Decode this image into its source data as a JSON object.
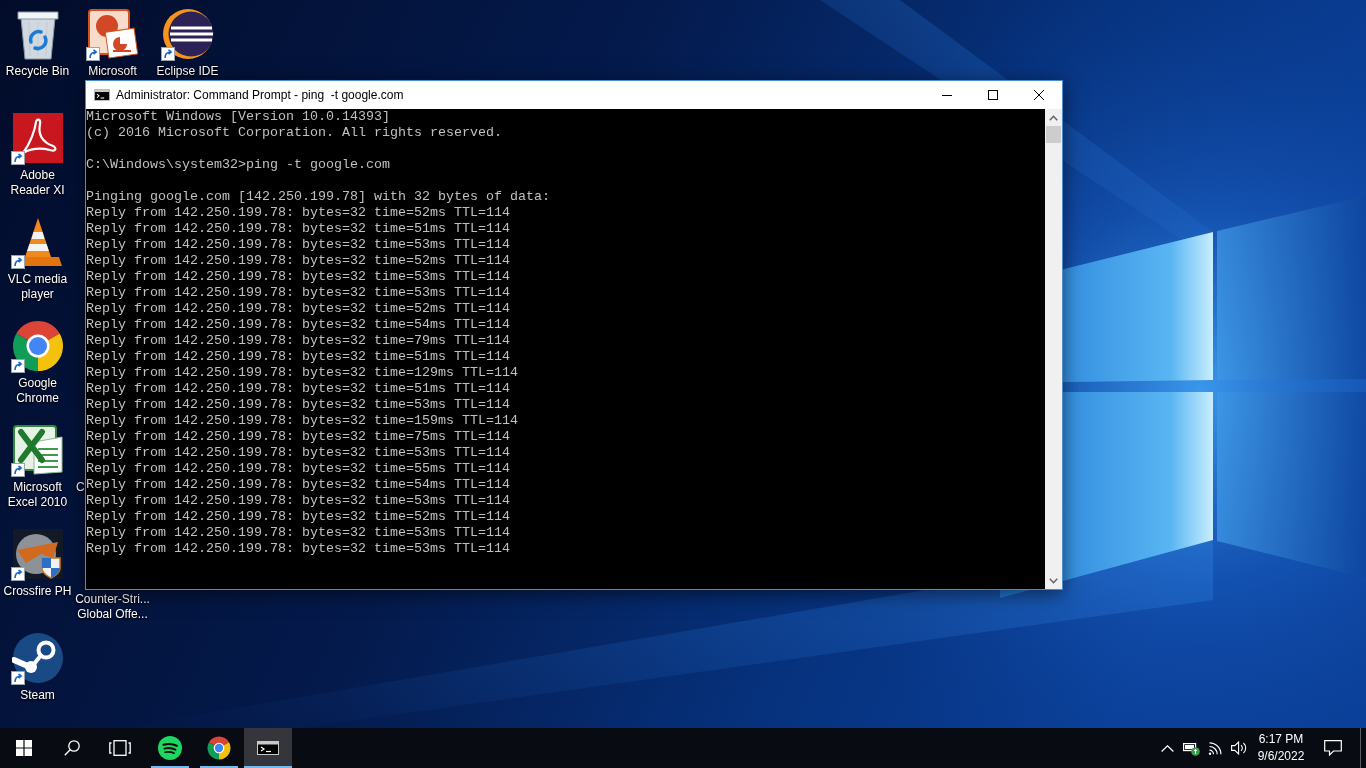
{
  "desktop_icons": [
    {
      "label": "Recycle Bin",
      "shortcut": false
    },
    {
      "label": "Adobe Reader XI",
      "shortcut": true
    },
    {
      "label": "VLC media player",
      "shortcut": true
    },
    {
      "label": "Google Chrome",
      "shortcut": true
    },
    {
      "label": "Microsoft Excel 2010",
      "shortcut": true
    },
    {
      "label": "Crossfire PH",
      "shortcut": true
    },
    {
      "label": "Steam",
      "shortcut": true
    },
    {
      "label": "Microsoft",
      "shortcut": true
    },
    {
      "label": "Eclipse IDE",
      "shortcut": true
    }
  ],
  "covered_icon_labels": [
    "C",
    "Counter-Stri... Global Offe..."
  ],
  "console_window": {
    "title": "Administrator: Command Prompt - ping  -t google.com",
    "blocks": [
      [
        "Microsoft Windows [Version 10.0.14393]",
        "(c) 2016 Microsoft Corporation. All rights reserved."
      ],
      [
        "C:\\Windows\\system32>ping -t google.com"
      ],
      [
        "Pinging google.com [142.250.199.78] with 32 bytes of data:",
        "Reply from 142.250.199.78: bytes=32 time=52ms TTL=114",
        "Reply from 142.250.199.78: bytes=32 time=51ms TTL=114",
        "Reply from 142.250.199.78: bytes=32 time=53ms TTL=114",
        "Reply from 142.250.199.78: bytes=32 time=52ms TTL=114",
        "Reply from 142.250.199.78: bytes=32 time=53ms TTL=114",
        "Reply from 142.250.199.78: bytes=32 time=53ms TTL=114",
        "Reply from 142.250.199.78: bytes=32 time=52ms TTL=114",
        "Reply from 142.250.199.78: bytes=32 time=54ms TTL=114",
        "Reply from 142.250.199.78: bytes=32 time=79ms TTL=114",
        "Reply from 142.250.199.78: bytes=32 time=51ms TTL=114",
        "Reply from 142.250.199.78: bytes=32 time=129ms TTL=114",
        "Reply from 142.250.199.78: bytes=32 time=51ms TTL=114",
        "Reply from 142.250.199.78: bytes=32 time=53ms TTL=114",
        "Reply from 142.250.199.78: bytes=32 time=159ms TTL=114",
        "Reply from 142.250.199.78: bytes=32 time=75ms TTL=114",
        "Reply from 142.250.199.78: bytes=32 time=53ms TTL=114",
        "Reply from 142.250.199.78: bytes=32 time=55ms TTL=114",
        "Reply from 142.250.199.78: bytes=32 time=54ms TTL=114",
        "Reply from 142.250.199.78: bytes=32 time=53ms TTL=114",
        "Reply from 142.250.199.78: bytes=32 time=52ms TTL=114",
        "Reply from 142.250.199.78: bytes=32 time=53ms TTL=114",
        "Reply from 142.250.199.78: bytes=32 time=53ms TTL=114"
      ]
    ]
  },
  "taskbar": {
    "apps": [
      {
        "running": true,
        "selected": false
      },
      {
        "running": true,
        "selected": false
      },
      {
        "running": true,
        "selected": true
      }
    ],
    "clock": {
      "time": "6:17 PM",
      "date": "9/6/2022"
    }
  }
}
